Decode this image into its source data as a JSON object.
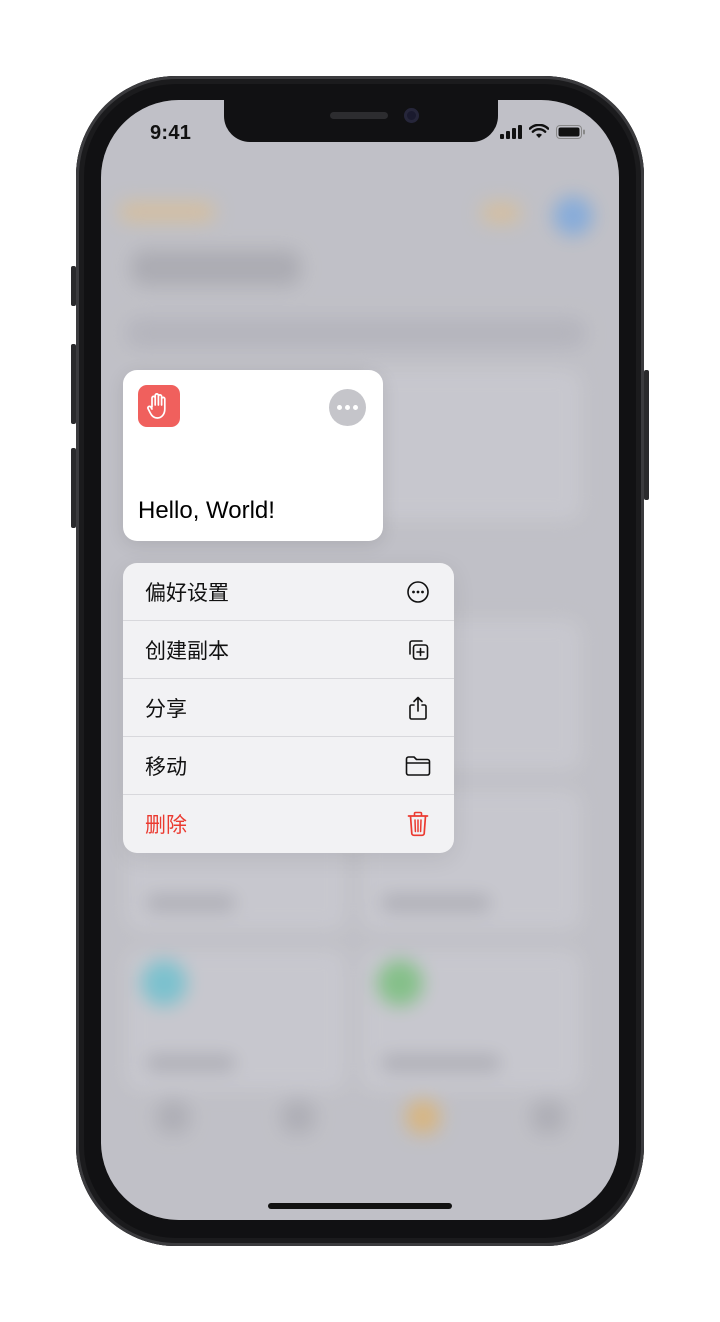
{
  "status_bar": {
    "time": "9:41",
    "icons": [
      "cellular-signal-icon",
      "wifi-icon",
      "battery-icon"
    ]
  },
  "card": {
    "icon": "hand-raised-icon",
    "icon_color": "#f0605d",
    "title": "Hello, World!",
    "more_icon": "ellipsis-icon"
  },
  "menu": {
    "items": [
      {
        "label": "偏好设置",
        "icon": "ellipsis-circle-icon"
      },
      {
        "label": "创建副本",
        "icon": "duplicate-icon"
      },
      {
        "label": "分享",
        "icon": "share-icon"
      },
      {
        "label": "移动",
        "icon": "folder-icon"
      },
      {
        "label": "删除",
        "icon": "trash-icon",
        "destructive": true
      }
    ]
  },
  "colors": {
    "destructive": "#eb3a30",
    "accent_blurred": "#f5a623"
  }
}
